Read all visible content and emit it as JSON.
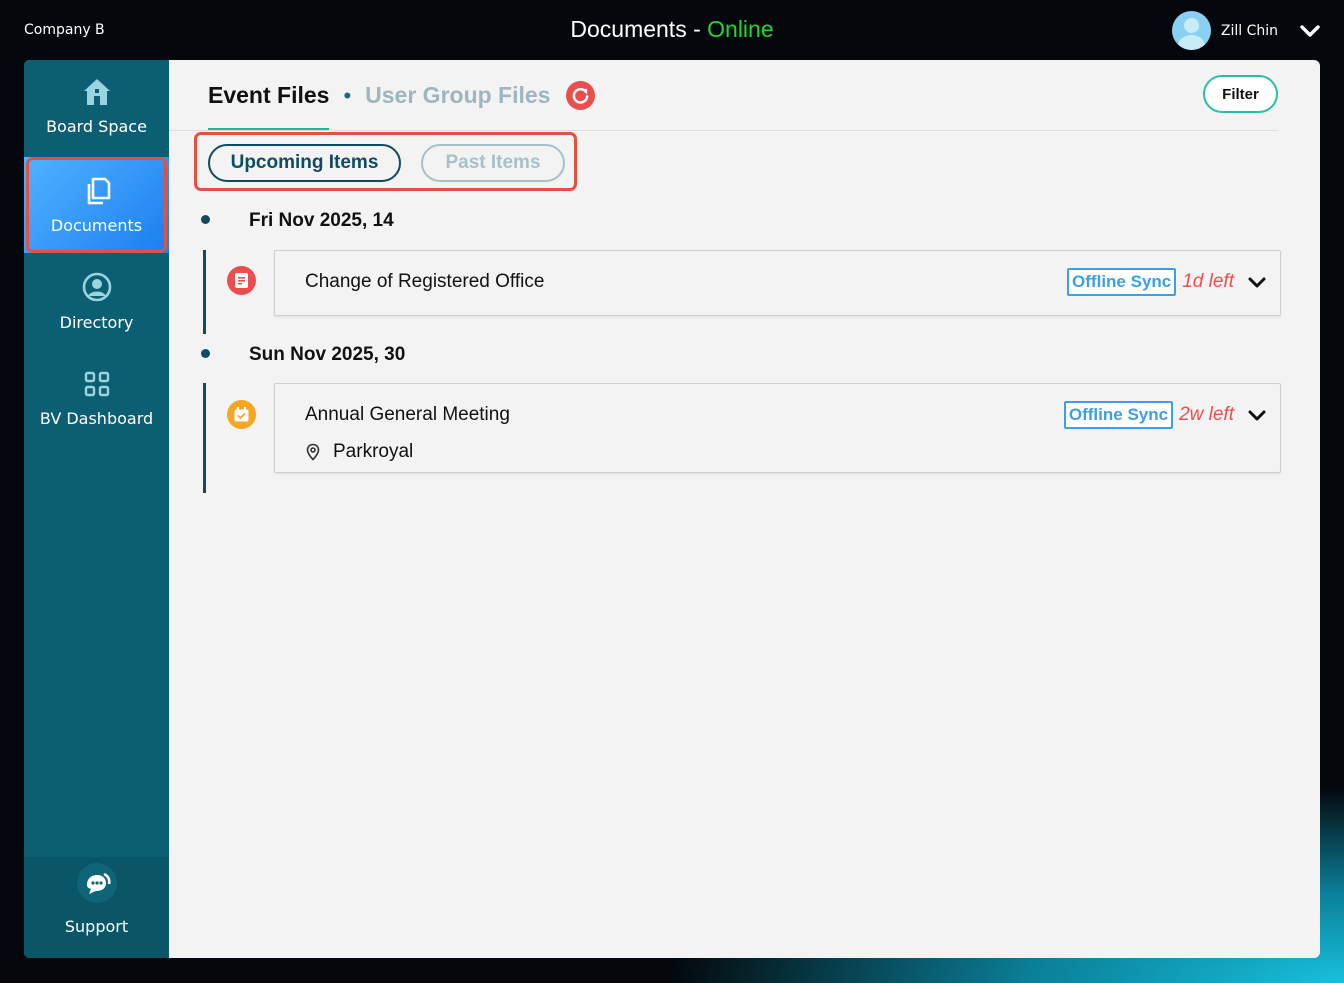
{
  "header": {
    "company": "Company B",
    "title": "Documents - ",
    "status": "Online",
    "user_name": "Zill Chin"
  },
  "sidebar": {
    "items": [
      {
        "label": "Board Space",
        "icon": "home-icon"
      },
      {
        "label": "Documents",
        "icon": "documents-icon",
        "active": true
      },
      {
        "label": "Directory",
        "icon": "user-circle-icon"
      },
      {
        "label": "BV Dashboard",
        "icon": "grid-icon"
      }
    ],
    "support_label": "Support"
  },
  "tabs": {
    "active": "Event Files",
    "inactive": "User Group Files"
  },
  "filter_label": "Filter",
  "segments": {
    "upcoming": "Upcoming Items",
    "past": "Past Items"
  },
  "events": [
    {
      "date": "Fri Nov 2025, 14",
      "name": "Change of Registered Office",
      "sync": "Offline Sync",
      "time_left": "1d left",
      "icon": "document-icon",
      "icon_color": "#ea4f4f"
    },
    {
      "date": "Sun Nov 2025, 30",
      "name": "Annual General Meeting",
      "location": "Parkroyal",
      "sync": "Offline Sync",
      "time_left": "2w left",
      "icon": "meeting-icon",
      "icon_color": "#f5a623"
    }
  ],
  "colors": {
    "sidebar": "#0c5f72",
    "accent": "#1fb59a",
    "online": "#22d62a",
    "alert": "#ea4f4f",
    "sync": "#3d9fe8"
  }
}
